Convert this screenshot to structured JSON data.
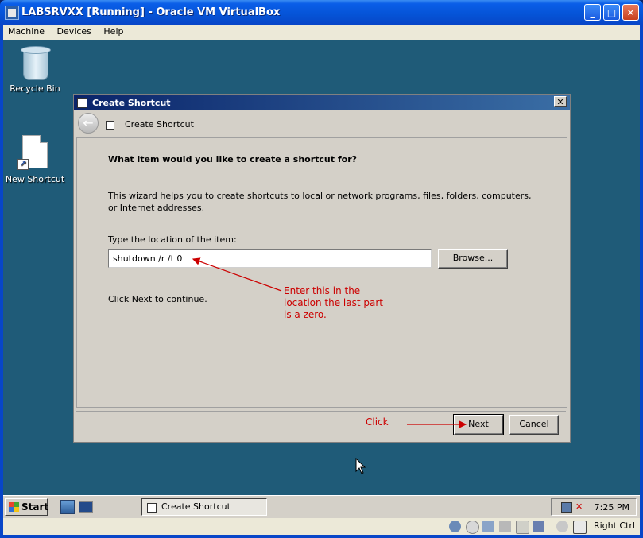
{
  "host": {
    "title": "LABSRVXX [Running] - Oracle VM VirtualBox",
    "menu": [
      "Machine",
      "Devices",
      "Help"
    ],
    "window_buttons": {
      "minimize": "_",
      "maximize": "□",
      "close": "✕"
    },
    "status": {
      "host_key": "Right Ctrl"
    }
  },
  "desktop": {
    "icons": [
      {
        "label": "Recycle Bin",
        "icon": "recycle-bin-icon"
      },
      {
        "label": "New Shortcut",
        "icon": "shortcut-file-icon"
      }
    ]
  },
  "dialog": {
    "title": "Create Shortcut",
    "header": "Create Shortcut",
    "question": "What item would you like to create a shortcut for?",
    "description": "This wizard helps you to create shortcuts to local or network programs, files, folders, computers, or Internet addresses.",
    "location_label": "Type the location of the item:",
    "location_value": "shutdown /r /t 0",
    "browse_label": "Browse...",
    "continue_text": "Click Next to continue.",
    "next_label": "Next",
    "cancel_label": "Cancel",
    "close_glyph": "✕"
  },
  "annotations": {
    "enter_note": [
      "Enter this in the",
      "location the last part",
      "is a zero."
    ],
    "click_note": "Click",
    "color": "#cc0000"
  },
  "taskbar": {
    "start_label": "Start",
    "task_button": "Create Shortcut",
    "clock": "7:25 PM"
  }
}
